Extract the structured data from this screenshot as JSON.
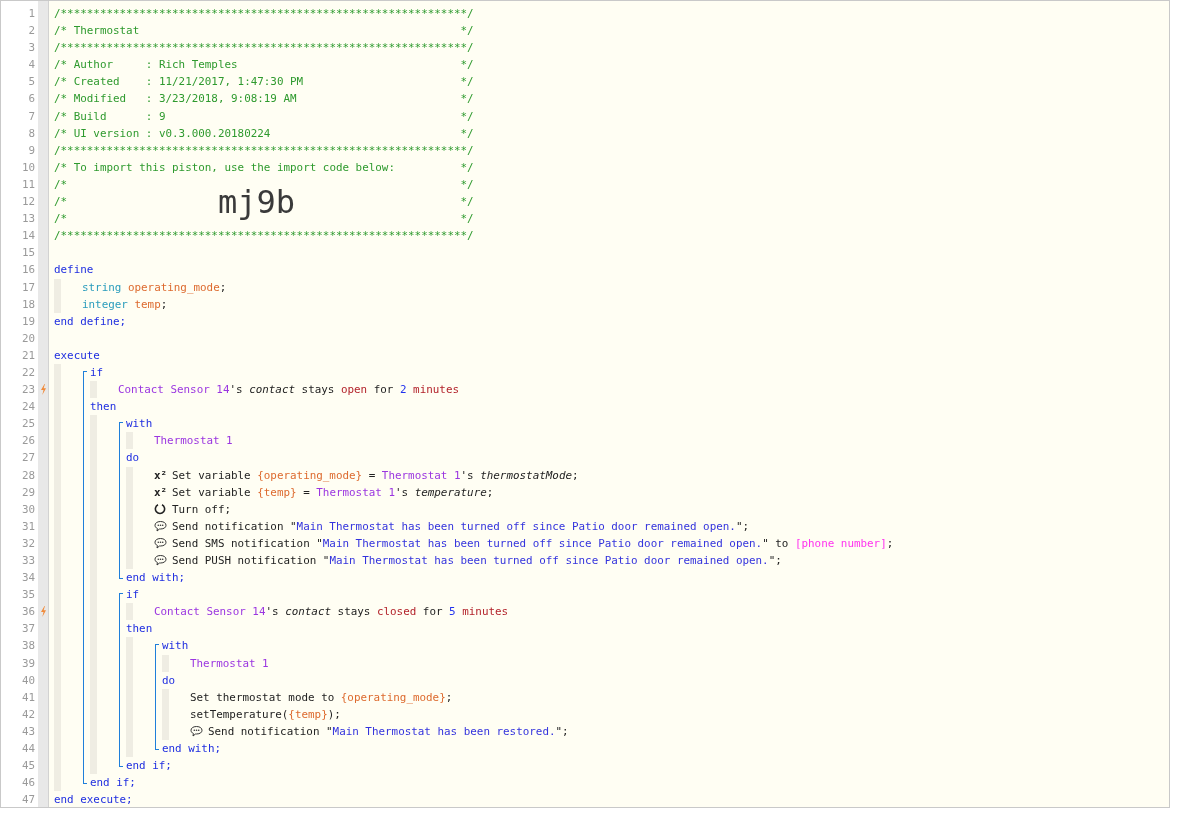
{
  "editor": {
    "lines": [
      {
        "kind": "line",
        "number": "1",
        "trigger": false,
        "tokens": [
          {
            "kind": "comment",
            "text": "/**************************************************************/"
          }
        ]
      },
      {
        "kind": "line",
        "number": "2",
        "trigger": false,
        "tokens": [
          {
            "kind": "comment",
            "text": "/* Thermostat"
          },
          {
            "kind": "comment-end",
            "text": "*/"
          }
        ]
      },
      {
        "kind": "line",
        "number": "3",
        "trigger": false,
        "tokens": [
          {
            "kind": "comment",
            "text": "/**************************************************************/"
          }
        ]
      },
      {
        "kind": "line",
        "number": "4",
        "trigger": false,
        "tokens": [
          {
            "kind": "comment",
            "text": "/* Author     : Rich Temples"
          },
          {
            "kind": "comment-end",
            "text": "*/"
          }
        ]
      },
      {
        "kind": "line",
        "number": "5",
        "trigger": false,
        "tokens": [
          {
            "kind": "comment",
            "text": "/* Created    : 11/21/2017, 1:47:30 PM"
          },
          {
            "kind": "comment-end",
            "text": "*/"
          }
        ]
      },
      {
        "kind": "line",
        "number": "6",
        "trigger": false,
        "tokens": [
          {
            "kind": "comment",
            "text": "/* Modified   : 3/23/2018, 9:08:19 AM"
          },
          {
            "kind": "comment-end",
            "text": "*/"
          }
        ]
      },
      {
        "kind": "line",
        "number": "7",
        "trigger": false,
        "tokens": [
          {
            "kind": "comment",
            "text": "/* Build      : 9"
          },
          {
            "kind": "comment-end",
            "text": "*/"
          }
        ]
      },
      {
        "kind": "line",
        "number": "8",
        "trigger": false,
        "tokens": [
          {
            "kind": "comment",
            "text": "/* UI version : v0.3.000.20180224"
          },
          {
            "kind": "comment-end",
            "text": "*/"
          }
        ]
      },
      {
        "kind": "line",
        "number": "9",
        "trigger": false,
        "tokens": [
          {
            "kind": "comment",
            "text": "/**************************************************************/"
          }
        ]
      },
      {
        "kind": "line",
        "number": "10",
        "trigger": false,
        "tokens": [
          {
            "kind": "comment",
            "text": "/* To import this piston, use the import code below:"
          },
          {
            "kind": "comment-end",
            "text": "*/"
          }
        ]
      },
      {
        "kind": "line",
        "number": "11",
        "trigger": false,
        "tokens": [
          {
            "kind": "comment",
            "text": "/*"
          },
          {
            "kind": "comment-end",
            "text": "*/"
          }
        ]
      },
      {
        "kind": "line",
        "number": "12",
        "trigger": false,
        "tokens": [
          {
            "kind": "comment",
            "text": "/*"
          },
          {
            "kind": "big",
            "text": "mj9b"
          },
          {
            "kind": "comment-end",
            "text": "*/"
          }
        ]
      },
      {
        "kind": "line",
        "number": "13",
        "trigger": false,
        "tokens": [
          {
            "kind": "comment",
            "text": "/*"
          },
          {
            "kind": "comment-end",
            "text": "*/"
          }
        ]
      },
      {
        "kind": "line",
        "number": "14",
        "trigger": false,
        "tokens": [
          {
            "kind": "comment",
            "text": "/**************************************************************/"
          }
        ]
      },
      {
        "kind": "line",
        "number": "15",
        "trigger": false
      },
      {
        "kind": "line",
        "number": "16",
        "trigger": false,
        "tokens": [
          {
            "kind": "keyword",
            "text": "define"
          }
        ],
        "children": [
          {
            "kind": "line",
            "number": "17",
            "trigger": false,
            "tokens": [
              {
                "kind": "type",
                "text": "string "
              },
              {
                "kind": "variable",
                "text": "operating_mode"
              },
              {
                "kind": "plain",
                "text": ";"
              }
            ]
          },
          {
            "kind": "line",
            "number": "18",
            "trigger": false,
            "tokens": [
              {
                "kind": "type",
                "text": "integer "
              },
              {
                "kind": "variable",
                "text": "temp"
              },
              {
                "kind": "plain",
                "text": ";"
              }
            ]
          }
        ]
      },
      {
        "kind": "line",
        "number": "19",
        "trigger": false,
        "tokens": [
          {
            "kind": "keyword",
            "text": "end define;"
          }
        ]
      },
      {
        "kind": "line",
        "number": "20",
        "trigger": false
      },
      {
        "kind": "line",
        "number": "21",
        "trigger": false,
        "tokens": [
          {
            "kind": "keyword",
            "text": "execute"
          }
        ],
        "children": [
          {
            "kind": "block",
            "lines": [
              {
                "kind": "line",
                "number": "22",
                "trigger": false,
                "tokens": [
                  {
                    "kind": "keyword",
                    "text": "if"
                  }
                ],
                "children": [
                  {
                    "kind": "line",
                    "number": "23",
                    "trigger": true,
                    "tokens": [
                      {
                        "kind": "device",
                        "text": "Contact Sensor 14"
                      },
                      {
                        "kind": "plain",
                        "text": "'s "
                      },
                      {
                        "kind": "attribute",
                        "text": "contact"
                      },
                      {
                        "kind": "plain",
                        "text": " stays "
                      },
                      {
                        "kind": "value",
                        "text": "open"
                      },
                      {
                        "kind": "plain",
                        "text": " for "
                      },
                      {
                        "kind": "number",
                        "text": "2 "
                      },
                      {
                        "kind": "value",
                        "text": "minutes"
                      }
                    ]
                  }
                ]
              },
              {
                "kind": "line",
                "number": "24",
                "trigger": false,
                "tokens": [
                  {
                    "kind": "keyword",
                    "text": "then"
                  }
                ],
                "children": [
                  {
                    "kind": "block",
                    "lines": [
                      {
                        "kind": "line",
                        "number": "25",
                        "trigger": false,
                        "tokens": [
                          {
                            "kind": "keyword",
                            "text": "with"
                          }
                        ],
                        "children": [
                          {
                            "kind": "line",
                            "number": "26",
                            "trigger": false,
                            "tokens": [
                              {
                                "kind": "device",
                                "text": "Thermostat 1"
                              }
                            ]
                          }
                        ]
                      },
                      {
                        "kind": "line",
                        "number": "27",
                        "trigger": false,
                        "tokens": [
                          {
                            "kind": "keyword",
                            "text": "do"
                          }
                        ],
                        "children": [
                          {
                            "kind": "line",
                            "number": "28",
                            "trigger": false,
                            "tokens": [
                              {
                                "kind": "symbol",
                                "text": "x²"
                              },
                              {
                                "kind": "plain",
                                "text": "Set variable "
                              },
                              {
                                "kind": "variable",
                                "text": "{operating_mode}"
                              },
                              {
                                "kind": "plain",
                                "text": " = "
                              },
                              {
                                "kind": "device",
                                "text": "Thermostat 1"
                              },
                              {
                                "kind": "plain",
                                "text": "'s "
                              },
                              {
                                "kind": "attribute",
                                "text": "thermostatMode"
                              },
                              {
                                "kind": "plain",
                                "text": ";"
                              }
                            ]
                          },
                          {
                            "kind": "line",
                            "number": "29",
                            "trigger": false,
                            "tokens": [
                              {
                                "kind": "symbol",
                                "text": "x²"
                              },
                              {
                                "kind": "plain",
                                "text": "Set variable "
                              },
                              {
                                "kind": "variable",
                                "text": "{temp}"
                              },
                              {
                                "kind": "plain",
                                "text": " = "
                              },
                              {
                                "kind": "device",
                                "text": "Thermostat 1"
                              },
                              {
                                "kind": "plain",
                                "text": "'s "
                              },
                              {
                                "kind": "attribute",
                                "text": "temperature"
                              },
                              {
                                "kind": "plain",
                                "text": ";"
                              }
                            ]
                          },
                          {
                            "kind": "line",
                            "number": "30",
                            "trigger": false,
                            "tokens": [
                              {
                                "kind": "power"
                              },
                              {
                                "kind": "plain",
                                "text": "Turn off;"
                              }
                            ]
                          },
                          {
                            "kind": "line",
                            "number": "31",
                            "trigger": false,
                            "tokens": [
                              {
                                "kind": "message"
                              },
                              {
                                "kind": "plain",
                                "text": "Send notification \""
                              },
                              {
                                "kind": "string",
                                "text": "Main Thermostat has been turned off since Patio door remained open."
                              },
                              {
                                "kind": "plain",
                                "text": "\";"
                              }
                            ]
                          },
                          {
                            "kind": "line",
                            "number": "32",
                            "trigger": false,
                            "tokens": [
                              {
                                "kind": "message"
                              },
                              {
                                "kind": "plain",
                                "text": "Send SMS notification \""
                              },
                              {
                                "kind": "string",
                                "text": "Main Thermostat has been turned off since Patio door remained open."
                              },
                              {
                                "kind": "plain",
                                "text": "\" to "
                              },
                              {
                                "kind": "placeholder",
                                "text": "[phone number]"
                              },
                              {
                                "kind": "plain",
                                "text": ";"
                              }
                            ]
                          },
                          {
                            "kind": "line",
                            "number": "33",
                            "trigger": false,
                            "tokens": [
                              {
                                "kind": "message"
                              },
                              {
                                "kind": "plain",
                                "text": "Send PUSH notification \""
                              },
                              {
                                "kind": "string",
                                "text": "Main Thermostat has been turned off since Patio door remained open."
                              },
                              {
                                "kind": "plain",
                                "text": "\";"
                              }
                            ]
                          }
                        ]
                      },
                      {
                        "kind": "line",
                        "number": "34",
                        "trigger": false,
                        "tokens": [
                          {
                            "kind": "keyword",
                            "text": "end with;"
                          }
                        ]
                      }
                    ]
                  },
                  {
                    "kind": "block",
                    "lines": [
                      {
                        "kind": "line",
                        "number": "35",
                        "trigger": false,
                        "tokens": [
                          {
                            "kind": "keyword",
                            "text": "if"
                          }
                        ],
                        "children": [
                          {
                            "kind": "line",
                            "number": "36",
                            "trigger": true,
                            "tokens": [
                              {
                                "kind": "device",
                                "text": "Contact Sensor 14"
                              },
                              {
                                "kind": "plain",
                                "text": "'s "
                              },
                              {
                                "kind": "attribute",
                                "text": "contact"
                              },
                              {
                                "kind": "plain",
                                "text": " stays "
                              },
                              {
                                "kind": "value",
                                "text": "closed"
                              },
                              {
                                "kind": "plain",
                                "text": " for "
                              },
                              {
                                "kind": "number",
                                "text": "5 "
                              },
                              {
                                "kind": "value",
                                "text": "minutes"
                              }
                            ]
                          }
                        ]
                      },
                      {
                        "kind": "line",
                        "number": "37",
                        "trigger": false,
                        "tokens": [
                          {
                            "kind": "keyword",
                            "text": "then"
                          }
                        ],
                        "children": [
                          {
                            "kind": "block",
                            "lines": [
                              {
                                "kind": "line",
                                "number": "38",
                                "trigger": false,
                                "tokens": [
                                  {
                                    "kind": "keyword",
                                    "text": "with"
                                  }
                                ],
                                "children": [
                                  {
                                    "kind": "line",
                                    "number": "39",
                                    "trigger": false,
                                    "tokens": [
                                      {
                                        "kind": "device",
                                        "text": "Thermostat 1"
                                      }
                                    ]
                                  }
                                ]
                              },
                              {
                                "kind": "line",
                                "number": "40",
                                "trigger": false,
                                "tokens": [
                                  {
                                    "kind": "keyword",
                                    "text": "do"
                                  }
                                ],
                                "children": [
                                  {
                                    "kind": "line",
                                    "number": "41",
                                    "trigger": false,
                                    "tokens": [
                                      {
                                        "kind": "plain",
                                        "text": "Set thermostat mode to "
                                      },
                                      {
                                        "kind": "variable",
                                        "text": "{operating_mode}"
                                      },
                                      {
                                        "kind": "plain",
                                        "text": ";"
                                      }
                                    ]
                                  },
                                  {
                                    "kind": "line",
                                    "number": "42",
                                    "trigger": false,
                                    "tokens": [
                                      {
                                        "kind": "plain",
                                        "text": "setTemperature("
                                      },
                                      {
                                        "kind": "variable",
                                        "text": "{temp}"
                                      },
                                      {
                                        "kind": "plain",
                                        "text": ");"
                                      }
                                    ]
                                  },
                                  {
                                    "kind": "line",
                                    "number": "43",
                                    "trigger": false,
                                    "tokens": [
                                      {
                                        "kind": "message"
                                      },
                                      {
                                        "kind": "plain",
                                        "text": "Send notification \""
                                      },
                                      {
                                        "kind": "string",
                                        "text": "Main Thermostat has been restored."
                                      },
                                      {
                                        "kind": "plain",
                                        "text": "\";"
                                      }
                                    ]
                                  }
                                ]
                              },
                              {
                                "kind": "line",
                                "number": "44",
                                "trigger": false,
                                "tokens": [
                                  {
                                    "kind": "keyword",
                                    "text": "end with;"
                                  }
                                ]
                              }
                            ]
                          }
                        ]
                      },
                      {
                        "kind": "line",
                        "number": "45",
                        "trigger": false,
                        "tokens": [
                          {
                            "kind": "keyword",
                            "text": "end if;"
                          }
                        ]
                      }
                    ]
                  }
                ]
              },
              {
                "kind": "line",
                "number": "46",
                "trigger": false,
                "tokens": [
                  {
                    "kind": "keyword",
                    "text": "end if;"
                  }
                ]
              }
            ]
          }
        ]
      },
      {
        "kind": "line",
        "number": "47",
        "trigger": false,
        "tokens": [
          {
            "kind": "keyword",
            "text": "end execute;"
          }
        ]
      }
    ]
  }
}
